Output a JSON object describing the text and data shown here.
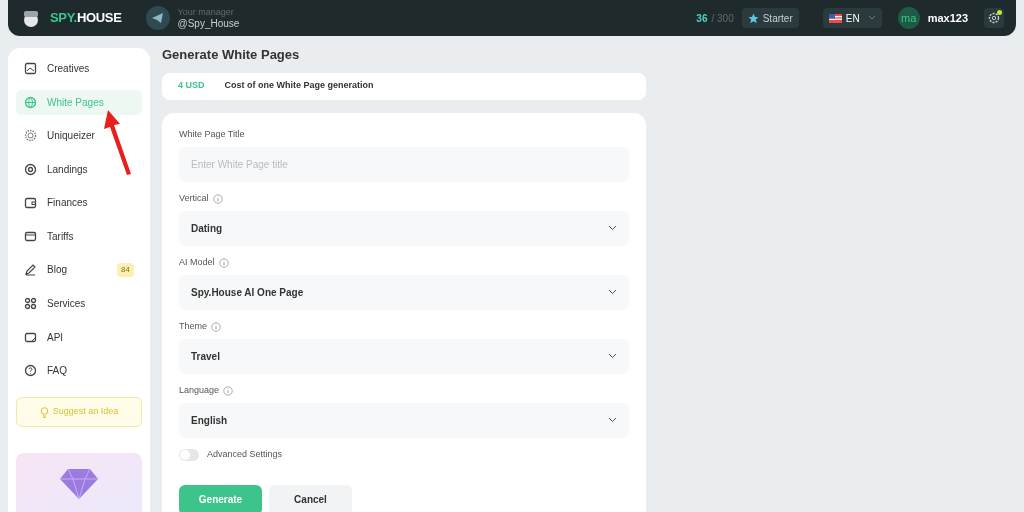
{
  "header": {
    "logo": {
      "accent": "SPY.",
      "rest": "HOUSE"
    },
    "manager_label": "Your manager",
    "manager_handle": "@Spy_House",
    "credits_used": "36",
    "credits_total": "/ 300",
    "plan": "Starter",
    "language": "EN",
    "avatar_initials": "ma",
    "username": "max123",
    "settings_notification": true
  },
  "sidebar": {
    "items": [
      {
        "label": "Creatives",
        "selected": false
      },
      {
        "label": "White Pages",
        "selected": true
      },
      {
        "label": "Uniqueizer",
        "selected": false
      },
      {
        "label": "Landings",
        "selected": false
      },
      {
        "label": "Finances",
        "selected": false
      },
      {
        "label": "Tariffs",
        "selected": false
      },
      {
        "label": "Blog",
        "selected": false,
        "badge": "84"
      },
      {
        "label": "Services",
        "selected": false
      },
      {
        "label": "API",
        "selected": false
      },
      {
        "label": "FAQ",
        "selected": false
      }
    ],
    "suggest_button": "Suggest an Idea"
  },
  "page_title": "Generate White Pages",
  "cost": {
    "price": "4 USD",
    "description": "Cost of one White Page generation"
  },
  "form": {
    "fields": [
      {
        "kind": "input",
        "label": "White Page Title",
        "placeholder": "Enter White Page title",
        "info": false
      },
      {
        "kind": "select",
        "label": "Vertical",
        "value": "Dating",
        "info": true
      },
      {
        "kind": "select",
        "label": "AI Model",
        "value": "Spy.House AI One Page",
        "info": true
      },
      {
        "kind": "select",
        "label": "Theme",
        "value": "Travel",
        "info": true
      },
      {
        "kind": "select",
        "label": "Language",
        "value": "English",
        "info": true
      }
    ],
    "advanced_toggle": {
      "label": "Advanced Settings",
      "on": false
    },
    "buttons": [
      {
        "kind": "primary",
        "label": "Generate"
      },
      {
        "kind": "secondary",
        "label": "Cancel"
      }
    ]
  }
}
